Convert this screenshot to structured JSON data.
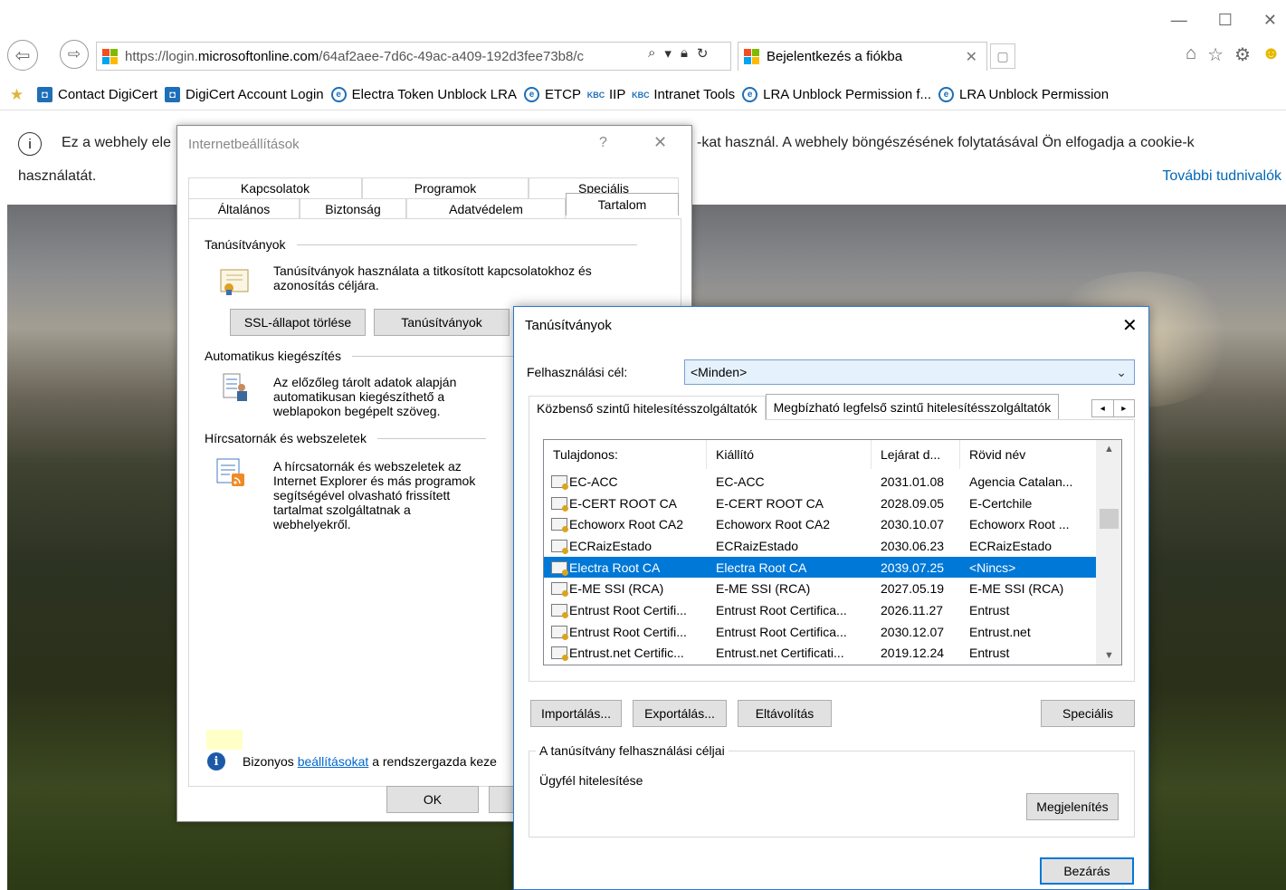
{
  "browser": {
    "address_prefix": "https://login.",
    "address_domain": "microsoftonline.com",
    "address_rest": "/64af2aee-7d6c-49ac-a409-192d3fee73b8/c",
    "tab_title": "Bejelentkezés a fiókba"
  },
  "favorites": [
    {
      "label": "Contact DigiCert",
      "icon": "digicert-icon"
    },
    {
      "label": "DigiCert Account Login",
      "icon": "digicert-icon"
    },
    {
      "label": "Electra Token Unblock LRA",
      "icon": "ie-icon"
    },
    {
      "label": "ETCP",
      "icon": "ie-icon"
    },
    {
      "label": "IIP",
      "icon": "kbc-icon"
    },
    {
      "label": "Intranet Tools",
      "icon": "kbc-icon"
    },
    {
      "label": "LRA Unblock Permission f...",
      "icon": "ie-icon"
    },
    {
      "label": "LRA Unblock Permission",
      "icon": "ie-icon"
    }
  ],
  "cookie": {
    "text_a": "Ez a webhely ele",
    "text_b": "-kat használ. A webhely böngészésének folytatásával Ön elfogadja a cookie-k",
    "text_line2": "használatát.",
    "more_link": "További tudnivalók"
  },
  "inet": {
    "title": "Internetbeállítások",
    "help": "?",
    "tabs_row1": [
      "Kapcsolatok",
      "Programok",
      "Speciális"
    ],
    "tabs_row2": [
      "Általános",
      "Biztonság",
      "Adatvédelem",
      "Tartalom"
    ],
    "certs_header": "Tanúsítványok",
    "certs_desc_1": "Tanúsítványok használata a titkosított kapcsolatokhoz és",
    "certs_desc_2": "azonosítás céljára.",
    "ssl_button": "SSL-állapot törlése",
    "certs_button": "Tanúsítványok",
    "autocomplete_header": "Automatikus kiegészítés",
    "autocomplete_desc": [
      "Az előzőleg tárolt adatok alapján",
      "automatikusan kiegészíthető a",
      "weblapokon begépelt szöveg."
    ],
    "feeds_header": "Hírcsatornák és webszeletek",
    "feeds_desc": [
      "A hírcsatornák és webszeletek az",
      "Internet Explorer és más programok",
      "segítségével olvasható frissített",
      "tartalmat szolgáltatnak a",
      "webhelyekről."
    ],
    "admin_note_pre": "Bizonyos ",
    "admin_note_link": "beállításokat",
    "admin_note_post": " a rendszergazda keze",
    "ok_button": "OK"
  },
  "certs": {
    "title": "Tanúsítványok",
    "purpose_label": "Felhasználási cél:",
    "purpose_value": "<Minden>",
    "tabs": [
      "Közbenső szintű hitelesítésszolgáltatók",
      "Megbízható legfelső szintű hitelesítésszolgáltatók"
    ],
    "columns": [
      "Tulajdonos:",
      "Kiállító",
      "Lejárat d...",
      "Rövid név"
    ],
    "rows": [
      {
        "owner": "EC-ACC",
        "issuer": "EC-ACC",
        "expires": "2031.01.08",
        "name": "Agencia Catalan..."
      },
      {
        "owner": "E-CERT ROOT CA",
        "issuer": "E-CERT ROOT CA",
        "expires": "2028.09.05",
        "name": "E-Certchile"
      },
      {
        "owner": "Echoworx Root CA2",
        "issuer": "Echoworx Root CA2",
        "expires": "2030.10.07",
        "name": "Echoworx Root ..."
      },
      {
        "owner": "ECRaizEstado",
        "issuer": "ECRaizEstado",
        "expires": "2030.06.23",
        "name": "ECRaizEstado"
      },
      {
        "owner": "Electra Root CA",
        "issuer": "Electra Root CA",
        "expires": "2039.07.25",
        "name": "<Nincs>",
        "selected": true
      },
      {
        "owner": "E-ME SSI (RCA)",
        "issuer": "E-ME SSI (RCA)",
        "expires": "2027.05.19",
        "name": "E-ME SSI (RCA)"
      },
      {
        "owner": "Entrust Root Certifi...",
        "issuer": "Entrust Root Certifica...",
        "expires": "2026.11.27",
        "name": "Entrust"
      },
      {
        "owner": "Entrust Root Certifi...",
        "issuer": "Entrust Root Certifica...",
        "expires": "2030.12.07",
        "name": "Entrust.net"
      },
      {
        "owner": "Entrust.net Certific...",
        "issuer": "Entrust.net Certificati...",
        "expires": "2019.12.24",
        "name": "Entrust"
      }
    ],
    "import_button": "Importálás...",
    "export_button": "Exportálás...",
    "remove_button": "Eltávolítás",
    "advanced_button": "Speciális",
    "purposes_group_label": "A tanúsítvány felhasználási céljai",
    "purposes_value": "Ügyfél hitelesítése",
    "view_button": "Megjelenítés",
    "close_button": "Bezárás"
  }
}
